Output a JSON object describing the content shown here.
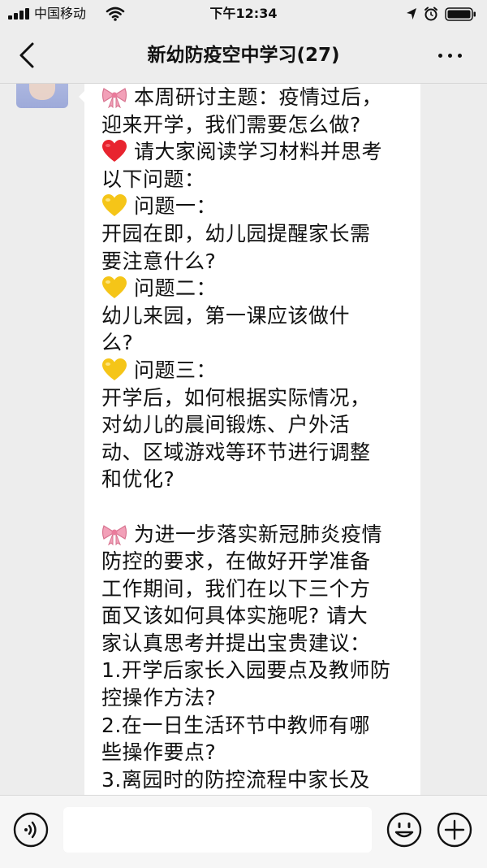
{
  "status_bar": {
    "carrier": "中国移动",
    "time": "下午12:34"
  },
  "nav": {
    "title": "新幼防疫空中学习(27)",
    "back_icon": "chevron-left-icon",
    "more_icon": "more-dots-icon"
  },
  "message": {
    "lines": [
      {
        "emoji": "bow-emoji",
        "text": "本周研讨主题：疫情过后，"
      },
      {
        "text": "迎来开学，我们需要怎么做?"
      },
      {
        "emoji": "red-heart-emoji",
        "text": "请大家阅读学习材料并思考"
      },
      {
        "text": "以下问题："
      },
      {
        "emoji": "yellow-heart-emoji",
        "text": "问题一："
      },
      {
        "text": "开园在即，幼儿园提醒家长需"
      },
      {
        "text": "要注意什么?"
      },
      {
        "emoji": "yellow-heart-emoji",
        "text": "问题二："
      },
      {
        "text": "幼儿来园，第一课应该做什"
      },
      {
        "text": "么?"
      },
      {
        "emoji": "yellow-heart-emoji",
        "text": "问题三："
      },
      {
        "text": "开学后，如何根据实际情况，"
      },
      {
        "text": "对幼儿的晨间锻炼、户外活"
      },
      {
        "text": "动、区域游戏等环节进行调整"
      },
      {
        "text": "和优化?"
      },
      {
        "text": ""
      },
      {
        "emoji": "bow-emoji",
        "text": "为进一步落实新冠肺炎疫情"
      },
      {
        "text": "防控的要求，在做好开学准备"
      },
      {
        "text": "工作期间，我们在以下三个方"
      },
      {
        "text": "面又该如何具体实施呢? 请大"
      },
      {
        "text": "家认真思考并提出宝贵建议："
      },
      {
        "text": "1.开学后家长入园要点及教师防"
      },
      {
        "text": "控操作方法?"
      },
      {
        "text": "2.在一日生活环节中教师有哪"
      },
      {
        "text": "些操作要点?"
      },
      {
        "text": "3.离园时的防控流程中家长及"
      }
    ]
  },
  "input_bar": {
    "voice_icon": "voice-icon",
    "emoji_icon": "smiley-icon",
    "plus_icon": "plus-icon",
    "input_value": ""
  },
  "colors": {
    "background": "#ededed",
    "bubble": "#ffffff",
    "heart_red": "#e8242f",
    "heart_yellow": "#f5c518",
    "bow_pink": "#f2a0b8"
  }
}
